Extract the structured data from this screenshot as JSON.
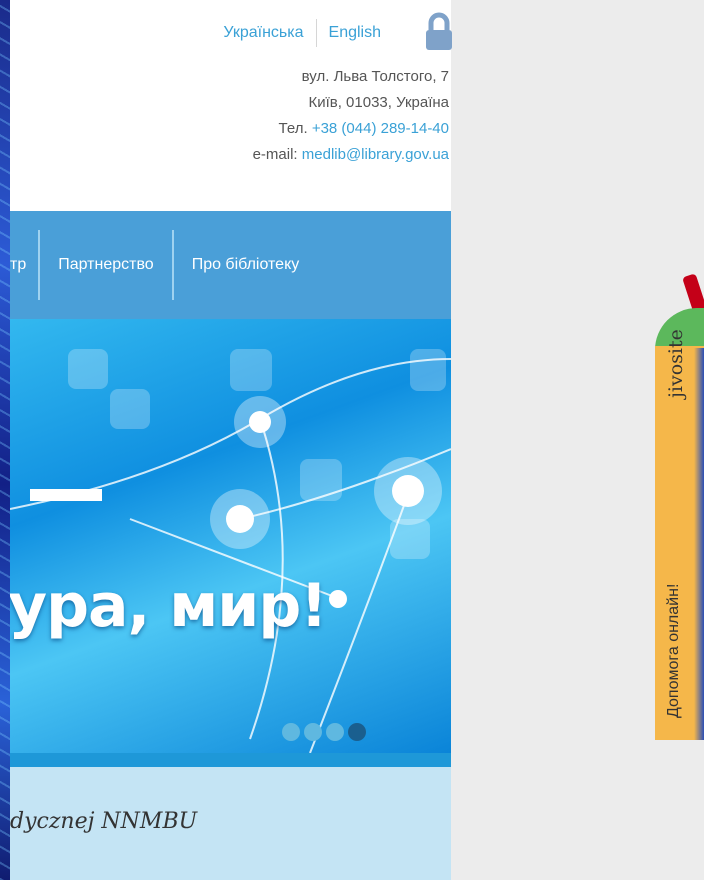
{
  "header": {
    "languages": [
      "Українська",
      "English"
    ],
    "address_line1": "вул. Льва Толстого, 7",
    "address_line2": "Київ, 01033, Україна",
    "phone_label": "Тел.",
    "phone": "+38 (044) 289-14-40",
    "email_label": "e-mail:",
    "email": "medlib@library.gov.ua"
  },
  "nav": {
    "items": [
      "тр",
      "Партнерство",
      "Про бібліотеку"
    ]
  },
  "banner": {
    "text": "ура, мир!",
    "slides": 4,
    "active_slide": 4
  },
  "info": {
    "text": "dycznej NNMBU"
  },
  "chat_widget": {
    "brand": "jivosite",
    "label": "Допомога онлайн!",
    "colors": {
      "body": "#f5b74a",
      "top": "#5cb85c",
      "accent": "#c40018"
    }
  },
  "colors": {
    "link": "#3aa1d6",
    "nav": "#4a9fd8",
    "info_band": "#c4e4f4"
  }
}
